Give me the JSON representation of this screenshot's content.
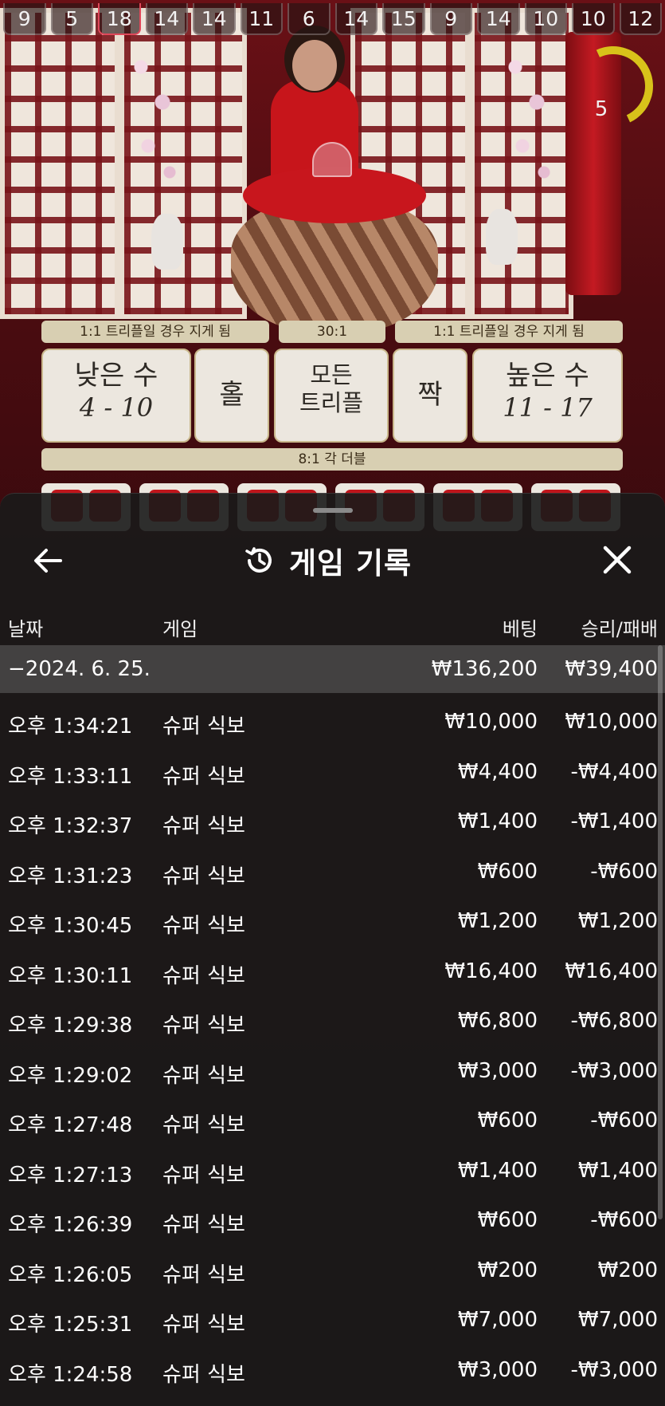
{
  "scene": {
    "recent_results": [
      {
        "value": "9",
        "highlight": false
      },
      {
        "value": "5",
        "highlight": false
      },
      {
        "value": "18",
        "highlight": true
      },
      {
        "value": "14",
        "highlight": false
      },
      {
        "value": "14",
        "highlight": false
      },
      {
        "value": "11",
        "highlight": false
      },
      {
        "value": "6",
        "highlight": false
      },
      {
        "value": "14",
        "highlight": false
      },
      {
        "value": "15",
        "highlight": false
      },
      {
        "value": "9",
        "highlight": false
      },
      {
        "value": "14",
        "highlight": false
      },
      {
        "value": "10",
        "highlight": false
      },
      {
        "value": "10",
        "highlight": false
      },
      {
        "value": "12",
        "highlight": false
      }
    ],
    "timer": "5",
    "payouts": {
      "small_note": "1:1 트리플일 경우 지게 됨",
      "triple_note": "30:1",
      "big_note": "1:1 트리플일 경우 지게 됨",
      "double_note": "8:1 각 더블"
    },
    "bets": {
      "small_label": "낮은 수",
      "small_range": "4 - 10",
      "odd_label": "홀",
      "any_triple_line1": "모든",
      "any_triple_line2": "트리플",
      "even_label": "짝",
      "big_label": "높은 수",
      "big_range": "11 - 17"
    }
  },
  "panel": {
    "title": "게임 기록",
    "icons": {
      "back": "arrow-left-icon",
      "history": "history-clock-icon",
      "close": "close-icon"
    },
    "columns": {
      "date": "날짜",
      "game": "게임",
      "bet": "베팅",
      "win_loss": "승리/패배"
    },
    "date_group": {
      "date": "−2024. 6. 25.",
      "bet_total": "₩136,200",
      "win_total": "₩39,400"
    },
    "rows": [
      {
        "time": "오후 1:34:21",
        "game": "슈퍼 식보",
        "bet": "₩10,000",
        "result": "₩10,000"
      },
      {
        "time": "오후 1:33:11",
        "game": "슈퍼 식보",
        "bet": "₩4,400",
        "result": "-₩4,400"
      },
      {
        "time": "오후 1:32:37",
        "game": "슈퍼 식보",
        "bet": "₩1,400",
        "result": "-₩1,400"
      },
      {
        "time": "오후 1:31:23",
        "game": "슈퍼 식보",
        "bet": "₩600",
        "result": "-₩600"
      },
      {
        "time": "오후 1:30:45",
        "game": "슈퍼 식보",
        "bet": "₩1,200",
        "result": "₩1,200"
      },
      {
        "time": "오후 1:30:11",
        "game": "슈퍼 식보",
        "bet": "₩16,400",
        "result": "₩16,400"
      },
      {
        "time": "오후 1:29:38",
        "game": "슈퍼 식보",
        "bet": "₩6,800",
        "result": "-₩6,800"
      },
      {
        "time": "오후 1:29:02",
        "game": "슈퍼 식보",
        "bet": "₩3,000",
        "result": "-₩3,000"
      },
      {
        "time": "오후 1:27:48",
        "game": "슈퍼 식보",
        "bet": "₩600",
        "result": "-₩600"
      },
      {
        "time": "오후 1:27:13",
        "game": "슈퍼 식보",
        "bet": "₩1,400",
        "result": "₩1,400"
      },
      {
        "time": "오후 1:26:39",
        "game": "슈퍼 식보",
        "bet": "₩600",
        "result": "-₩600"
      },
      {
        "time": "오후 1:26:05",
        "game": "슈퍼 식보",
        "bet": "₩200",
        "result": "₩200"
      },
      {
        "time": "오후 1:25:31",
        "game": "슈퍼 식보",
        "bet": "₩7,000",
        "result": "₩7,000"
      },
      {
        "time": "오후 1:24:58",
        "game": "슈퍼 식보",
        "bet": "₩3,000",
        "result": "-₩3,000"
      }
    ]
  }
}
